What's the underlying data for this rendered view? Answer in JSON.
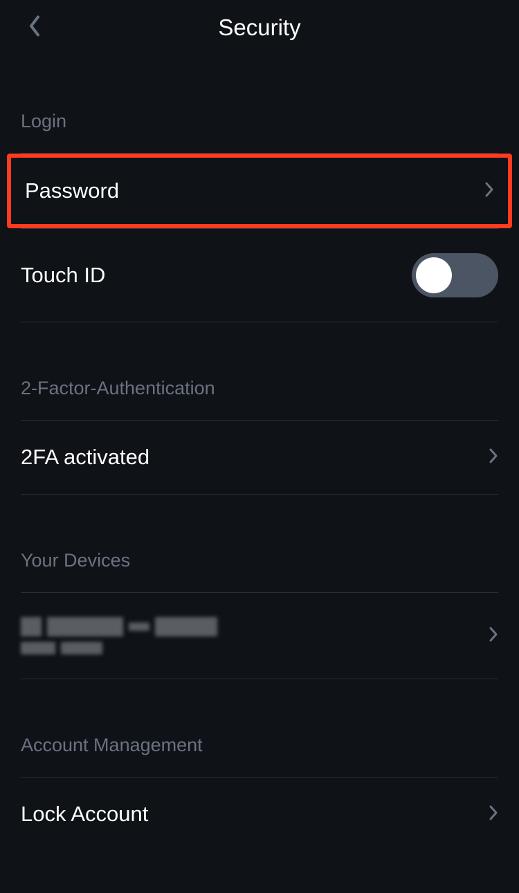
{
  "header": {
    "title": "Security"
  },
  "sections": {
    "login": {
      "title": "Login",
      "password_label": "Password",
      "touchid_label": "Touch ID",
      "touchid_enabled": false
    },
    "twofa": {
      "title": "2-Factor-Authentication",
      "status_label": "2FA activated"
    },
    "devices": {
      "title": "Your Devices"
    },
    "account": {
      "title": "Account Management",
      "lock_label": "Lock Account"
    }
  },
  "colors": {
    "highlight": "#ff3b1f",
    "background": "#0f1318",
    "muted": "#6b7280"
  }
}
